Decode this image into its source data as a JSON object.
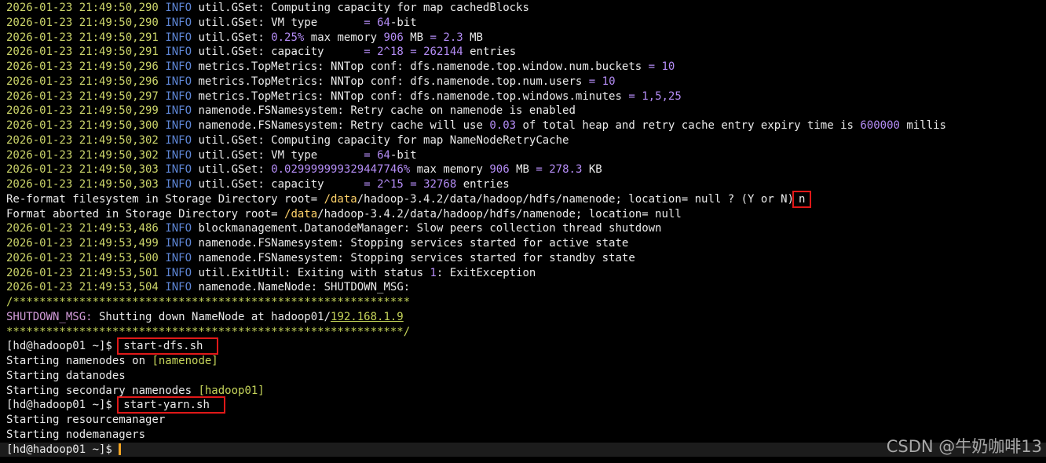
{
  "colors": {
    "background": "#000000",
    "text": "#eaeaea",
    "timestamp": "#ccd56a",
    "level": "#5e86d6",
    "number": "#b48cf5",
    "path": "#ffd26a",
    "highlight_box": "#e01818",
    "cursor": "#f5a623"
  },
  "log_lines": [
    {
      "ts": "2026-01-23 21:49:50,290",
      "level": "INFO",
      "msg": "util.GSet: Computing capacity for map cachedBlocks"
    },
    {
      "ts": "2026-01-23 21:49:50,290",
      "level": "INFO",
      "msg": "util.GSet: VM type       = 64-bit"
    },
    {
      "ts": "2026-01-23 21:49:50,291",
      "level": "INFO",
      "msg": "util.GSet: 0.25% max memory 906 MB = 2.3 MB"
    },
    {
      "ts": "2026-01-23 21:49:50,291",
      "level": "INFO",
      "msg": "util.GSet: capacity      = 2^18 = 262144 entries"
    },
    {
      "ts": "2026-01-23 21:49:50,296",
      "level": "INFO",
      "msg": "metrics.TopMetrics: NNTop conf: dfs.namenode.top.window.num.buckets = 10"
    },
    {
      "ts": "2026-01-23 21:49:50,296",
      "level": "INFO",
      "msg": "metrics.TopMetrics: NNTop conf: dfs.namenode.top.num.users = 10"
    },
    {
      "ts": "2026-01-23 21:49:50,297",
      "level": "INFO",
      "msg": "metrics.TopMetrics: NNTop conf: dfs.namenode.top.windows.minutes = 1,5,25"
    },
    {
      "ts": "2026-01-23 21:49:50,299",
      "level": "INFO",
      "msg": "namenode.FSNamesystem: Retry cache on namenode is enabled"
    },
    {
      "ts": "2026-01-23 21:49:50,300",
      "level": "INFO",
      "msg": "namenode.FSNamesystem: Retry cache will use 0.03 of total heap and retry cache entry expiry time is 600000 millis"
    },
    {
      "ts": "2026-01-23 21:49:50,302",
      "level": "INFO",
      "msg": "util.GSet: Computing capacity for map NameNodeRetryCache"
    },
    {
      "ts": "2026-01-23 21:49:50,302",
      "level": "INFO",
      "msg": "util.GSet: VM type       = 64-bit"
    },
    {
      "ts": "2026-01-23 21:49:50,303",
      "level": "INFO",
      "msg": "util.GSet: 0.029999999329447746% max memory 906 MB = 278.3 KB"
    },
    {
      "ts": "2026-01-23 21:49:50,303",
      "level": "INFO",
      "msg": "util.GSet: capacity      = 2^15 = 32768 entries"
    }
  ],
  "reformat_prompt": {
    "prefix": "Re-format filesystem in Storage Directory root= ",
    "path": "/data",
    "path_rest": "/hadoop-3.4.2/data/hadoop/hdfs/namenode; location= null ? (Y or N)",
    "answer": "n"
  },
  "format_aborted": {
    "prefix": "Format aborted in Storage Directory root= ",
    "path": "/data",
    "path_rest": "/hadoop-3.4.2/data/hadoop/hdfs/namenode; location= null"
  },
  "log_lines_2": [
    {
      "ts": "2026-01-23 21:49:53,486",
      "level": "INFO",
      "msg": "blockmanagement.DatanodeManager: Slow peers collection thread shutdown"
    },
    {
      "ts": "2026-01-23 21:49:53,499",
      "level": "INFO",
      "msg": "namenode.FSNamesystem: Stopping services started for active state"
    },
    {
      "ts": "2026-01-23 21:49:53,500",
      "level": "INFO",
      "msg": "namenode.FSNamesystem: Stopping services started for standby state"
    },
    {
      "ts": "2026-01-23 21:49:53,501",
      "level": "INFO",
      "msg": "util.ExitUtil: Exiting with status 1: ExitException"
    },
    {
      "ts": "2026-01-23 21:49:53,504",
      "level": "INFO",
      "msg": "namenode.NameNode: SHUTDOWN_MSG:"
    }
  ],
  "stars_open": "/************************************************************",
  "shutdown": {
    "label": "SHUTDOWN_MSG:",
    "text": " Shutting down NameNode at hadoop01/",
    "ip": "192.168.1.9"
  },
  "stars_close": "************************************************************/",
  "prompt": "[hd@hadoop01 ~]$ ",
  "cmd_dfs": "start-dfs.sh",
  "dfs_out": {
    "namenodes": "Starting namenodes on [namenode]",
    "datanodes": "Starting datanodes",
    "secondary": "Starting secondary namenodes [hadoop01]"
  },
  "cmd_yarn": "start-yarn.sh",
  "yarn_out": {
    "resourcemanager": "Starting resourcemanager",
    "nodemanagers": "Starting nodemanagers"
  },
  "watermark": "CSDN @牛奶咖啡13"
}
